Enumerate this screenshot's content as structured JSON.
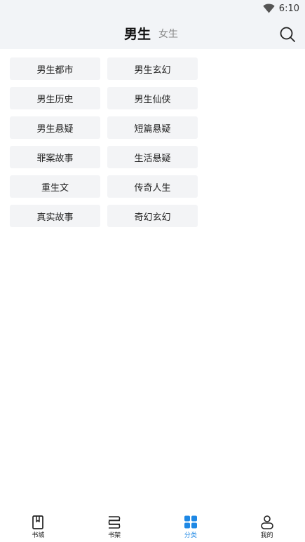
{
  "status": {
    "time": "6:10",
    "wifi_icon": "wifi-icon"
  },
  "header": {
    "tabs": [
      {
        "label": "男生",
        "active": true
      },
      {
        "label": "女生",
        "active": false
      }
    ],
    "search_icon": "search-icon"
  },
  "categories": [
    "男生都市",
    "男生玄幻",
    "男生历史",
    "男生仙侠",
    "男生悬疑",
    "短篇悬疑",
    "罪案故事",
    "生活悬疑",
    "重生文",
    "传奇人生",
    "真实故事",
    "奇幻玄幻"
  ],
  "bottom_nav": [
    {
      "label": "书城",
      "icon": "bookmark-book-icon",
      "active": false
    },
    {
      "label": "书架",
      "icon": "bookshelf-icon",
      "active": false
    },
    {
      "label": "分类",
      "icon": "grid-icon",
      "active": true
    },
    {
      "label": "我的",
      "icon": "person-icon",
      "active": false
    }
  ],
  "colors": {
    "accent": "#1e88e5",
    "header_bg": "#f2f4f7",
    "tag_bg": "#f3f4f6"
  }
}
